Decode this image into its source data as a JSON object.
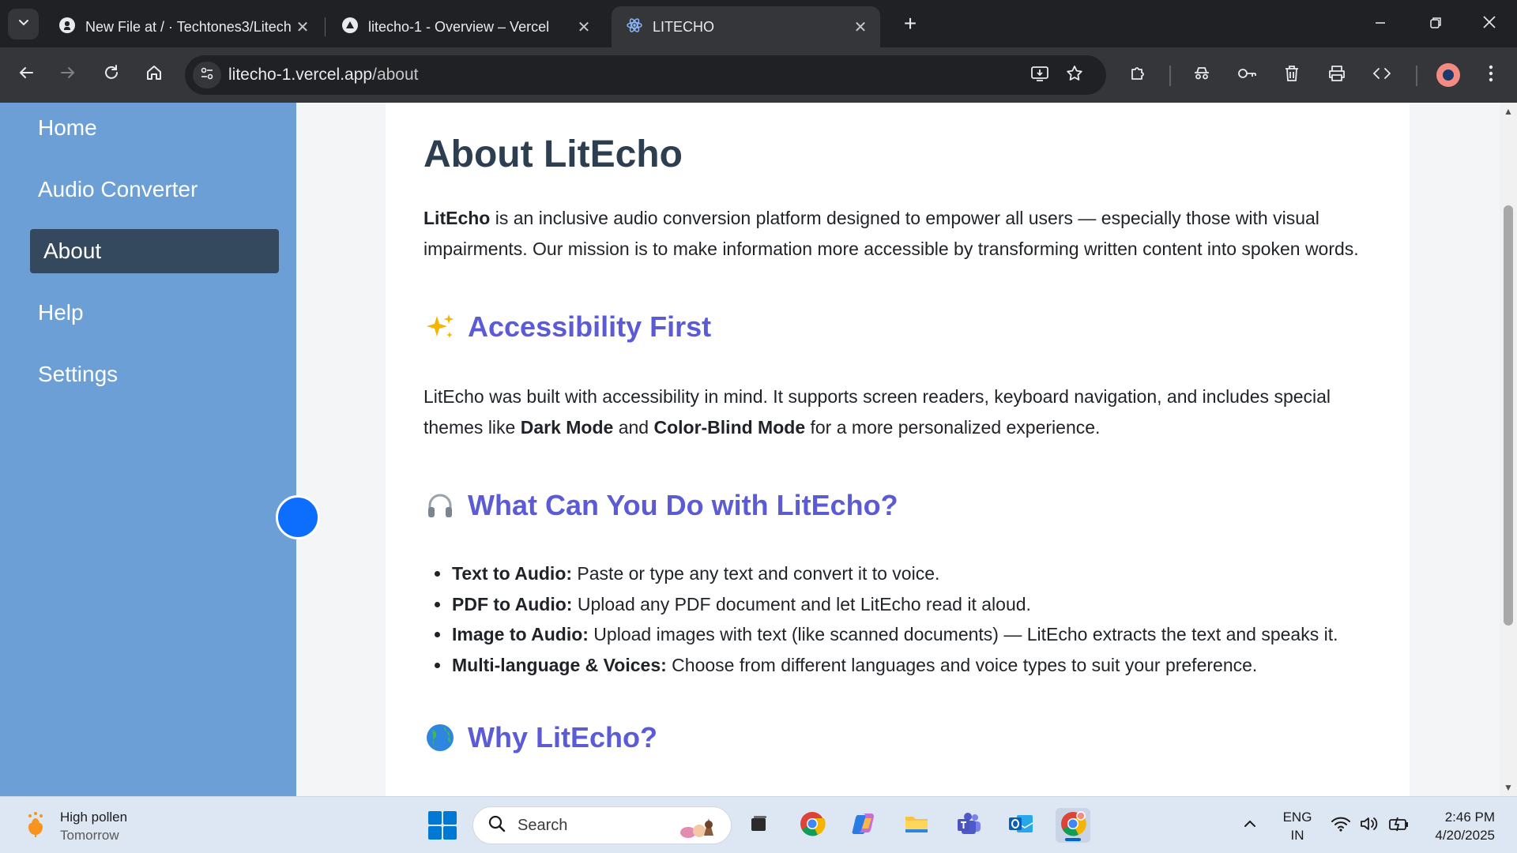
{
  "browser": {
    "tabs": [
      {
        "title": "New File at / · Techtones3/Litech",
        "icon": "github-icon"
      },
      {
        "title": "litecho-1 - Overview – Vercel",
        "icon": "vercel-icon"
      },
      {
        "title": "LITECHO",
        "icon": "react-icon",
        "active": true
      }
    ],
    "url_host": "litecho-1.vercel.app",
    "url_path": "/about"
  },
  "sidebar": {
    "items": [
      {
        "label": "Home"
      },
      {
        "label": "Audio Converter"
      },
      {
        "label": "About",
        "active": true
      },
      {
        "label": "Help"
      },
      {
        "label": "Settings"
      }
    ]
  },
  "page": {
    "title": "About LitEcho",
    "intro_bold": "LitEcho",
    "intro_rest": " is an inclusive audio conversion platform designed to empower all users — especially those with visual impairments. Our mission is to make information more accessible by transforming written content into spoken words.",
    "sections": [
      {
        "emoji": "✨",
        "heading": "Accessibility First"
      },
      {
        "emoji": "🎧",
        "heading": "What Can You Do with LitEcho?"
      },
      {
        "emoji": "🌍",
        "heading": "Why LitEcho?"
      }
    ],
    "accessibility": {
      "text_1": "LitEcho was built with accessibility in mind. It supports screen readers, keyboard navigation, and includes special themes like ",
      "bold_1": "Dark Mode",
      "text_2": " and ",
      "bold_2": "Color-Blind Mode",
      "text_3": " for a more personalized experience."
    },
    "features": [
      {
        "name": "Text to Audio:",
        "desc": " Paste or type any text and convert it to voice."
      },
      {
        "name": "PDF to Audio:",
        "desc": " Upload any PDF document and let LitEcho read it aloud."
      },
      {
        "name": "Image to Audio:",
        "desc": " Upload images with text (like scanned documents) — LitEcho extracts the text and speaks it."
      },
      {
        "name": "Multi-language & Voices:",
        "desc": " Choose from different languages and voice types to suit your preference."
      }
    ]
  },
  "taskbar": {
    "weather_title": "High pollen",
    "weather_sub": "Tomorrow",
    "search_label": "Search",
    "lang_1": "ENG",
    "lang_2": "IN",
    "time": "2:46 PM",
    "date": "4/20/2025"
  },
  "colors": {
    "sidebar": "#6b9fd6",
    "nav_active": "#34495e",
    "heading_accent": "#5b5bd6",
    "title": "#2c3e50"
  }
}
